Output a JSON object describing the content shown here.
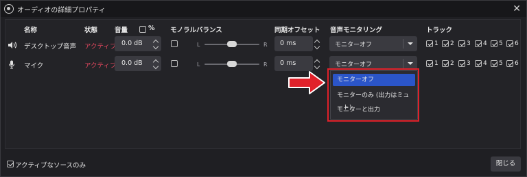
{
  "window": {
    "title": "オーディオの詳細プロパティ",
    "close_glyph": "✕"
  },
  "headers": {
    "name": "名称",
    "status": "状態",
    "volume": "音量",
    "percent": "%",
    "mono": "モノラル",
    "balance": "バランス",
    "sync_offset": "同期オフセット",
    "monitoring": "音声モニタリング",
    "tracks": "トラック"
  },
  "balance_labels": {
    "left": "L",
    "right": "R"
  },
  "rows": [
    {
      "name": "デスクトップ音声",
      "icon": "speaker-icon",
      "status": "アクティブ",
      "volume": "0.0 dB",
      "mono_checked": false,
      "balance": 0.5,
      "sync_offset": "0 ms",
      "monitoring": "モニターオフ",
      "tracks": [
        "1",
        "2",
        "3",
        "4",
        "5",
        "6"
      ],
      "tracks_checked": [
        true,
        true,
        true,
        true,
        true,
        true
      ]
    },
    {
      "name": "マイク",
      "icon": "microphone-icon",
      "status": "アクティブ",
      "volume": "0.0 dB",
      "mono_checked": false,
      "balance": 0.5,
      "sync_offset": "0 ms",
      "monitoring": "モニターオフ",
      "tracks": [
        "1",
        "2",
        "3",
        "4",
        "5",
        "6"
      ],
      "tracks_checked": [
        true,
        true,
        true,
        true,
        true,
        true
      ]
    }
  ],
  "monitoring_menu": {
    "options": [
      "モニターオフ",
      "モニターのみ (出力はミュート)",
      "モニターと出力"
    ],
    "selected_index": 0
  },
  "footer": {
    "active_only_label": "アクティブなソースのみ",
    "active_only_checked": true,
    "close_label": "閉じる"
  },
  "colors": {
    "status_active": "#d6455b",
    "menu_selected": "#2b55c8",
    "highlight_border": "#e0212a"
  }
}
